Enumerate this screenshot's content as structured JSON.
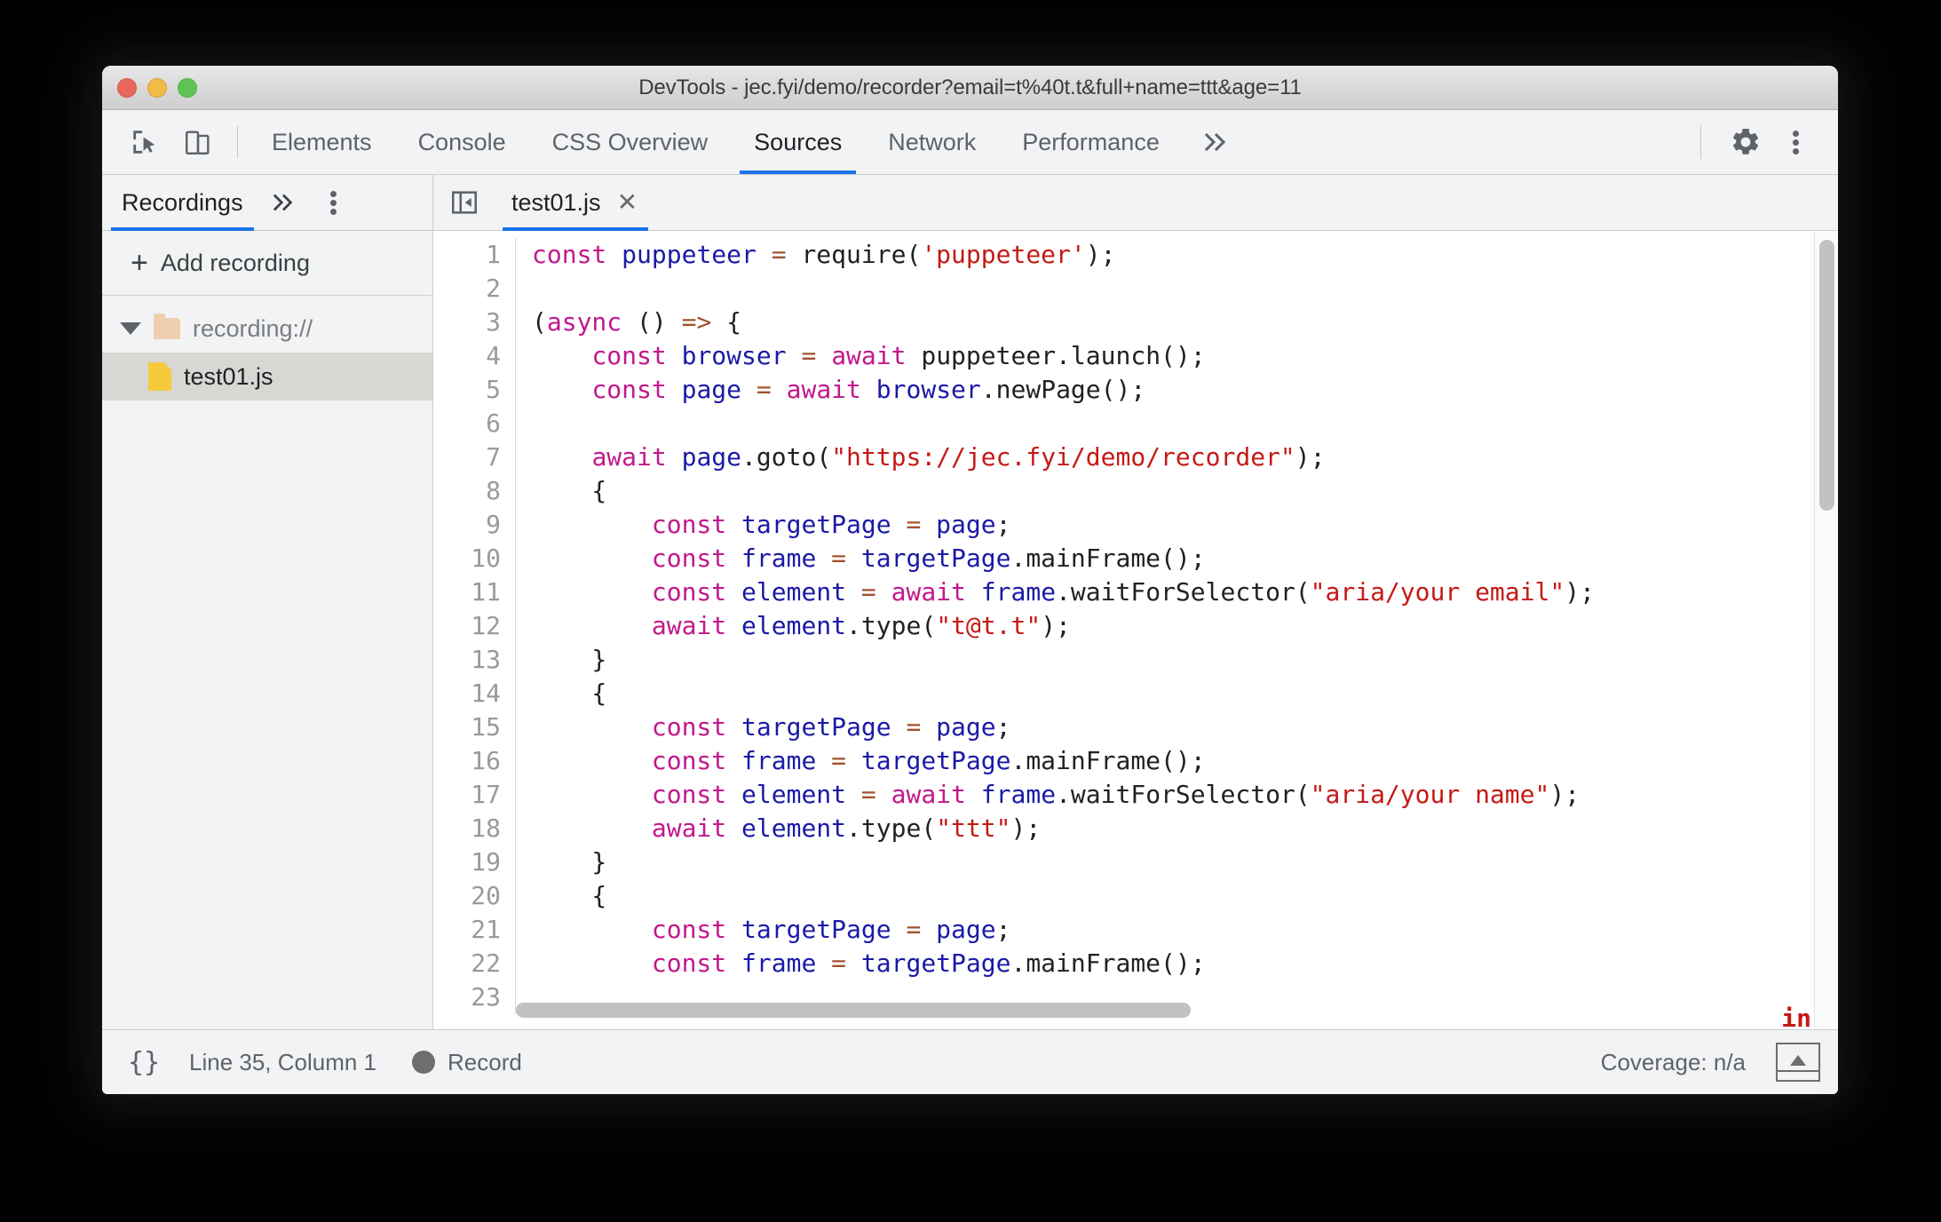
{
  "window": {
    "title": "DevTools - jec.fyi/demo/recorder?email=t%40t.t&full+name=ttt&age=11",
    "traffic_lights": [
      "close",
      "minimize",
      "zoom"
    ]
  },
  "toolbar": {
    "inspect_icon": "inspect-cursor-icon",
    "device_icon": "device-toolbar-icon",
    "tabs": [
      {
        "label": "Elements",
        "active": false
      },
      {
        "label": "Console",
        "active": false
      },
      {
        "label": "CSS Overview",
        "active": false
      },
      {
        "label": "Sources",
        "active": true
      },
      {
        "label": "Network",
        "active": false
      },
      {
        "label": "Performance",
        "active": false
      }
    ],
    "more_tabs_icon": "chevron-double-right-icon",
    "settings_icon": "gear-icon",
    "main_menu_icon": "kebab-menu-icon",
    "accent_color": "#1a73e8",
    "background_color": "#f1f3f4"
  },
  "sidebar": {
    "tab_label": "Recordings",
    "more_icon": "chevron-double-right-icon",
    "kebab_icon": "kebab-menu-icon",
    "add_recording_label": "Add recording",
    "add_icon": "plus-icon",
    "tree": [
      {
        "label": "recording://",
        "type": "folder",
        "expanded": true,
        "selected": false
      },
      {
        "label": "test01.js",
        "type": "file",
        "expanded": false,
        "selected": true
      }
    ]
  },
  "editor": {
    "nav_toggle_icon": "show-navigator-icon",
    "tab_label": "test01.js",
    "close_icon": "close-icon",
    "clipped_fragment": "in",
    "lines": [
      {
        "n": "1",
        "tokens": [
          {
            "t": "const",
            "c": "kw"
          },
          {
            "t": " ",
            "c": "pun"
          },
          {
            "t": "puppeteer",
            "c": "var"
          },
          {
            "t": " ",
            "c": "pun"
          },
          {
            "t": "=",
            "c": "op"
          },
          {
            "t": " require(",
            "c": "pun"
          },
          {
            "t": "'puppeteer'",
            "c": "str"
          },
          {
            "t": ");",
            "c": "pun"
          }
        ]
      },
      {
        "n": "2",
        "tokens": []
      },
      {
        "n": "3",
        "tokens": [
          {
            "t": "(",
            "c": "pun"
          },
          {
            "t": "async",
            "c": "kw"
          },
          {
            "t": " () ",
            "c": "pun"
          },
          {
            "t": "=>",
            "c": "op"
          },
          {
            "t": " {",
            "c": "pun"
          }
        ]
      },
      {
        "n": "4",
        "tokens": [
          {
            "t": "    ",
            "c": "pun"
          },
          {
            "t": "const",
            "c": "kw"
          },
          {
            "t": " ",
            "c": "pun"
          },
          {
            "t": "browser",
            "c": "var"
          },
          {
            "t": " ",
            "c": "pun"
          },
          {
            "t": "=",
            "c": "op"
          },
          {
            "t": " ",
            "c": "pun"
          },
          {
            "t": "await",
            "c": "kw"
          },
          {
            "t": " puppeteer.launch();",
            "c": "pun"
          }
        ]
      },
      {
        "n": "5",
        "tokens": [
          {
            "t": "    ",
            "c": "pun"
          },
          {
            "t": "const",
            "c": "kw"
          },
          {
            "t": " ",
            "c": "pun"
          },
          {
            "t": "page",
            "c": "var"
          },
          {
            "t": " ",
            "c": "pun"
          },
          {
            "t": "=",
            "c": "op"
          },
          {
            "t": " ",
            "c": "pun"
          },
          {
            "t": "await",
            "c": "kw"
          },
          {
            "t": " ",
            "c": "pun"
          },
          {
            "t": "browser",
            "c": "var"
          },
          {
            "t": ".newPage();",
            "c": "pun"
          }
        ]
      },
      {
        "n": "6",
        "tokens": []
      },
      {
        "n": "7",
        "tokens": [
          {
            "t": "    ",
            "c": "pun"
          },
          {
            "t": "await",
            "c": "kw"
          },
          {
            "t": " ",
            "c": "pun"
          },
          {
            "t": "page",
            "c": "var"
          },
          {
            "t": ".goto(",
            "c": "pun"
          },
          {
            "t": "\"https://jec.fyi/demo/recorder\"",
            "c": "str"
          },
          {
            "t": ");",
            "c": "pun"
          }
        ]
      },
      {
        "n": "8",
        "tokens": [
          {
            "t": "    {",
            "c": "pun"
          }
        ]
      },
      {
        "n": "9",
        "tokens": [
          {
            "t": "        ",
            "c": "pun"
          },
          {
            "t": "const",
            "c": "kw"
          },
          {
            "t": " ",
            "c": "pun"
          },
          {
            "t": "targetPage",
            "c": "var"
          },
          {
            "t": " ",
            "c": "pun"
          },
          {
            "t": "=",
            "c": "op"
          },
          {
            "t": " ",
            "c": "pun"
          },
          {
            "t": "page",
            "c": "var"
          },
          {
            "t": ";",
            "c": "pun"
          }
        ]
      },
      {
        "n": "10",
        "tokens": [
          {
            "t": "        ",
            "c": "pun"
          },
          {
            "t": "const",
            "c": "kw"
          },
          {
            "t": " ",
            "c": "pun"
          },
          {
            "t": "frame",
            "c": "var"
          },
          {
            "t": " ",
            "c": "pun"
          },
          {
            "t": "=",
            "c": "op"
          },
          {
            "t": " ",
            "c": "pun"
          },
          {
            "t": "targetPage",
            "c": "var"
          },
          {
            "t": ".mainFrame();",
            "c": "pun"
          }
        ]
      },
      {
        "n": "11",
        "tokens": [
          {
            "t": "        ",
            "c": "pun"
          },
          {
            "t": "const",
            "c": "kw"
          },
          {
            "t": " ",
            "c": "pun"
          },
          {
            "t": "element",
            "c": "var"
          },
          {
            "t": " ",
            "c": "pun"
          },
          {
            "t": "=",
            "c": "op"
          },
          {
            "t": " ",
            "c": "pun"
          },
          {
            "t": "await",
            "c": "kw"
          },
          {
            "t": " ",
            "c": "pun"
          },
          {
            "t": "frame",
            "c": "var"
          },
          {
            "t": ".waitForSelector(",
            "c": "pun"
          },
          {
            "t": "\"aria/your email\"",
            "c": "str"
          },
          {
            "t": ");",
            "c": "pun"
          }
        ]
      },
      {
        "n": "12",
        "tokens": [
          {
            "t": "        ",
            "c": "pun"
          },
          {
            "t": "await",
            "c": "kw"
          },
          {
            "t": " ",
            "c": "pun"
          },
          {
            "t": "element",
            "c": "var"
          },
          {
            "t": ".type(",
            "c": "pun"
          },
          {
            "t": "\"t@t.t\"",
            "c": "str"
          },
          {
            "t": ");",
            "c": "pun"
          }
        ]
      },
      {
        "n": "13",
        "tokens": [
          {
            "t": "    }",
            "c": "pun"
          }
        ]
      },
      {
        "n": "14",
        "tokens": [
          {
            "t": "    {",
            "c": "pun"
          }
        ]
      },
      {
        "n": "15",
        "tokens": [
          {
            "t": "        ",
            "c": "pun"
          },
          {
            "t": "const",
            "c": "kw"
          },
          {
            "t": " ",
            "c": "pun"
          },
          {
            "t": "targetPage",
            "c": "var"
          },
          {
            "t": " ",
            "c": "pun"
          },
          {
            "t": "=",
            "c": "op"
          },
          {
            "t": " ",
            "c": "pun"
          },
          {
            "t": "page",
            "c": "var"
          },
          {
            "t": ";",
            "c": "pun"
          }
        ]
      },
      {
        "n": "16",
        "tokens": [
          {
            "t": "        ",
            "c": "pun"
          },
          {
            "t": "const",
            "c": "kw"
          },
          {
            "t": " ",
            "c": "pun"
          },
          {
            "t": "frame",
            "c": "var"
          },
          {
            "t": " ",
            "c": "pun"
          },
          {
            "t": "=",
            "c": "op"
          },
          {
            "t": " ",
            "c": "pun"
          },
          {
            "t": "targetPage",
            "c": "var"
          },
          {
            "t": ".mainFrame();",
            "c": "pun"
          }
        ]
      },
      {
        "n": "17",
        "tokens": [
          {
            "t": "        ",
            "c": "pun"
          },
          {
            "t": "const",
            "c": "kw"
          },
          {
            "t": " ",
            "c": "pun"
          },
          {
            "t": "element",
            "c": "var"
          },
          {
            "t": " ",
            "c": "pun"
          },
          {
            "t": "=",
            "c": "op"
          },
          {
            "t": " ",
            "c": "pun"
          },
          {
            "t": "await",
            "c": "kw"
          },
          {
            "t": " ",
            "c": "pun"
          },
          {
            "t": "frame",
            "c": "var"
          },
          {
            "t": ".waitForSelector(",
            "c": "pun"
          },
          {
            "t": "\"aria/your name\"",
            "c": "str"
          },
          {
            "t": ");",
            "c": "pun"
          }
        ]
      },
      {
        "n": "18",
        "tokens": [
          {
            "t": "        ",
            "c": "pun"
          },
          {
            "t": "await",
            "c": "kw"
          },
          {
            "t": " ",
            "c": "pun"
          },
          {
            "t": "element",
            "c": "var"
          },
          {
            "t": ".type(",
            "c": "pun"
          },
          {
            "t": "\"ttt\"",
            "c": "str"
          },
          {
            "t": ");",
            "c": "pun"
          }
        ]
      },
      {
        "n": "19",
        "tokens": [
          {
            "t": "    }",
            "c": "pun"
          }
        ]
      },
      {
        "n": "20",
        "tokens": [
          {
            "t": "    {",
            "c": "pun"
          }
        ]
      },
      {
        "n": "21",
        "tokens": [
          {
            "t": "        ",
            "c": "pun"
          },
          {
            "t": "const",
            "c": "kw"
          },
          {
            "t": " ",
            "c": "pun"
          },
          {
            "t": "targetPage",
            "c": "var"
          },
          {
            "t": " ",
            "c": "pun"
          },
          {
            "t": "=",
            "c": "op"
          },
          {
            "t": " ",
            "c": "pun"
          },
          {
            "t": "page",
            "c": "var"
          },
          {
            "t": ";",
            "c": "pun"
          }
        ]
      },
      {
        "n": "22",
        "tokens": [
          {
            "t": "        ",
            "c": "pun"
          },
          {
            "t": "const",
            "c": "kw"
          },
          {
            "t": " ",
            "c": "pun"
          },
          {
            "t": "frame",
            "c": "var"
          },
          {
            "t": " ",
            "c": "pun"
          },
          {
            "t": "=",
            "c": "op"
          },
          {
            "t": " ",
            "c": "pun"
          },
          {
            "t": "targetPage",
            "c": "var"
          },
          {
            "t": ".mainFrame();",
            "c": "pun"
          }
        ]
      },
      {
        "n": "23",
        "tokens": []
      }
    ],
    "syntax_colors": {
      "keyword": "#c2188c",
      "variable": "#1a1aa6",
      "operator": "#a0522d",
      "string": "#c41a16",
      "plain": "#202124",
      "line_number": "#9a9a9a"
    }
  },
  "status_bar": {
    "pretty_print_label": "{}",
    "cursor_position": "Line 35, Column 1",
    "record_label": "Record",
    "record_icon": "record-dot-icon",
    "coverage_label": "Coverage: n/a",
    "drawer_icon": "show-drawer-icon"
  }
}
